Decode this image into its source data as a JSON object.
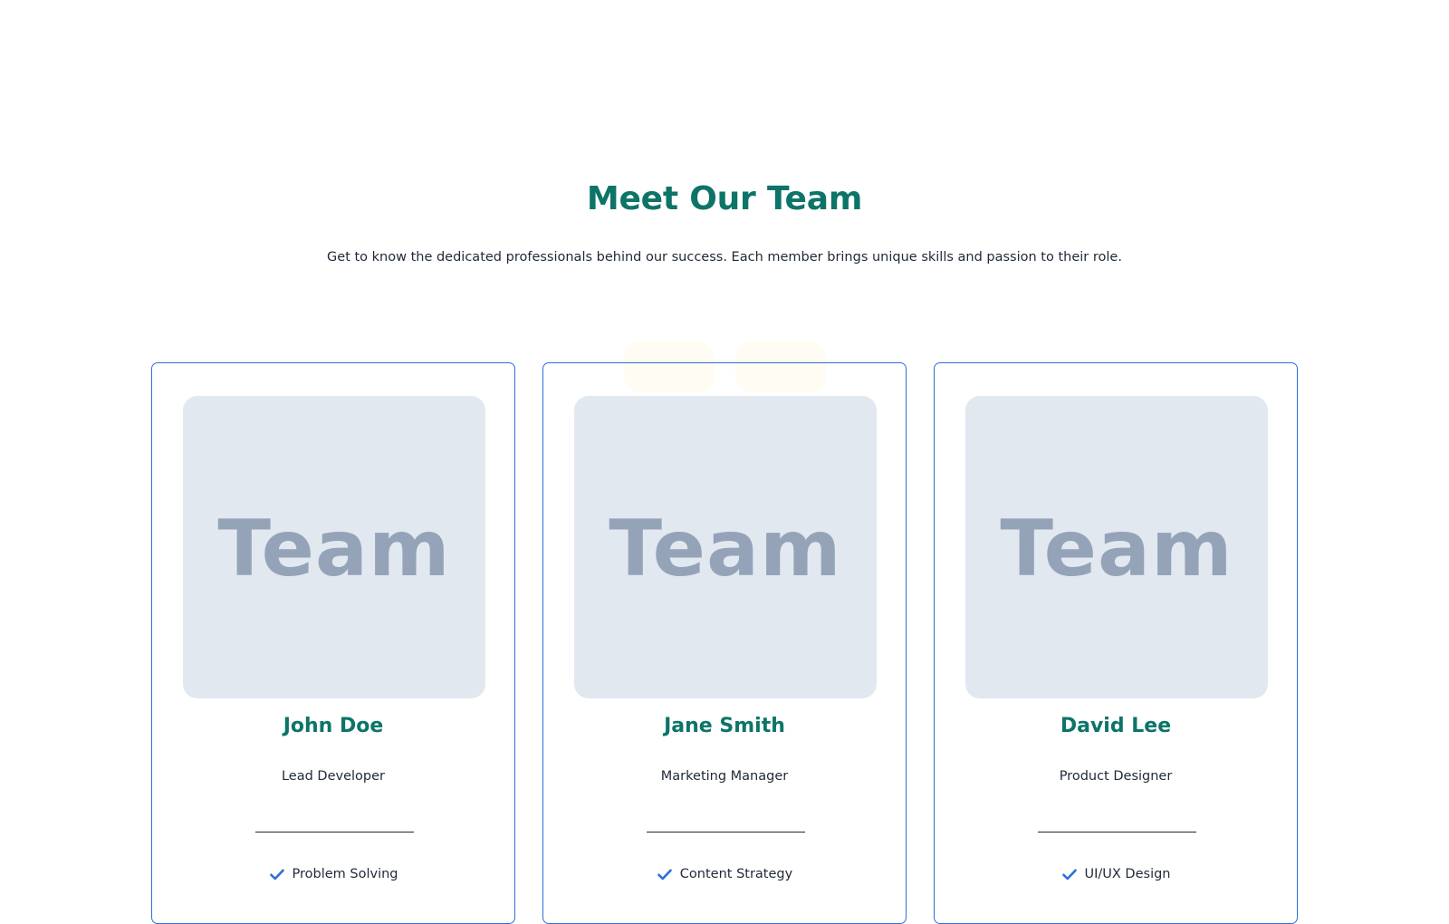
{
  "header": {
    "title": "Meet Our Team",
    "subtitle": "Get to know the dedicated professionals behind our success. Each member brings unique skills and passion to their role."
  },
  "team": [
    {
      "photo_placeholder": "Team",
      "name": "John Doe",
      "role": "Lead Developer",
      "skill": "Problem Solving"
    },
    {
      "photo_placeholder": "Team",
      "name": "Jane Smith",
      "role": "Marketing Manager",
      "skill": "Content Strategy"
    },
    {
      "photo_placeholder": "Team",
      "name": "David Lee",
      "role": "Product Designer",
      "skill": "UI/UX Design"
    }
  ],
  "icons": {
    "skill_icon": "check-icon"
  },
  "colors": {
    "heading": "#0d7468",
    "card_border": "#2f6fdb",
    "check": "#2f6fdb",
    "photo_bg": "#e2e8f0",
    "photo_text": "#94a3b8"
  }
}
